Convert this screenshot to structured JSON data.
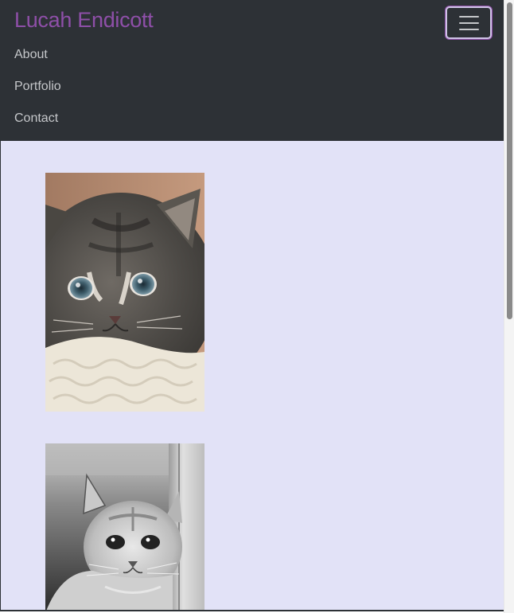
{
  "navbar": {
    "brand": "Lucah Endicott",
    "toggler_icon": "hamburger-menu-icon",
    "links": [
      {
        "label": "About"
      },
      {
        "label": "Portfolio"
      },
      {
        "label": "Contact"
      }
    ]
  },
  "gallery": {
    "images": [
      {
        "subject": "tabby-kitten-photo"
      },
      {
        "subject": "black-and-white-kitten-photo"
      }
    ]
  },
  "colors": {
    "navbar_bg": "#2d3136",
    "brand": "#8e4fa8",
    "page_bg": "#e2e2f7",
    "nav_link": "#c5c7ca"
  }
}
